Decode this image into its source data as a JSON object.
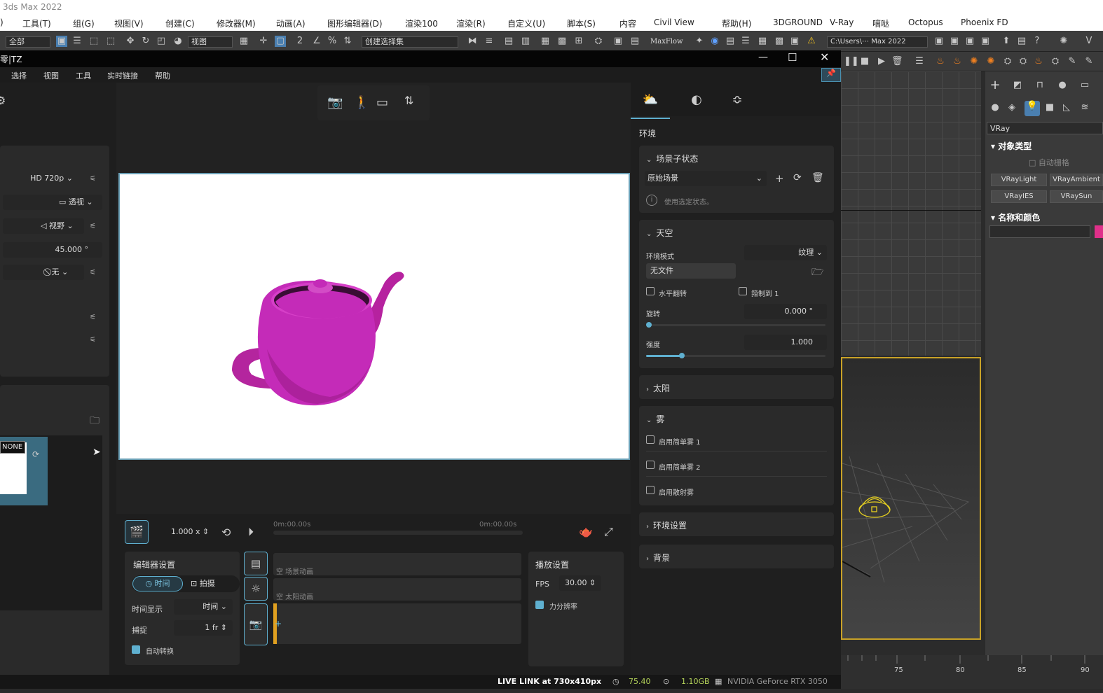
{
  "max": {
    "title": "3ds Max 2022",
    "menus": [
      "工具(T)",
      "组(G)",
      "视图(V)",
      "创建(C)",
      "修改器(M)",
      "动画(A)",
      "图形编辑器(D)",
      "渲染100",
      "渲染(R)",
      "自定义(U)",
      "脚本(S)",
      "内容",
      "Civil View",
      "帮助(H)",
      "3DGROUND",
      "V-Ray",
      "嘀哒",
      "Octopus",
      "Phoenix FD"
    ],
    "selection_filter": "全部",
    "ref_coord": "视图",
    "named_sel": "创建选择集",
    "maxflow": "MaxFlow",
    "path": "C:\\Users\\⋯ Max 2022",
    "cmd": {
      "category": "VRay",
      "section_object_type": "对象类型",
      "autogrid": "自动栅格",
      "buttons": [
        "VRayLight",
        "VRayAmbient",
        "VRayIES",
        "VRaySun"
      ],
      "section_name_color": "名称和颜色"
    },
    "ruler": [
      "75",
      "80",
      "85",
      "90"
    ]
  },
  "vantage": {
    "title": "零|TZ",
    "menus": [
      "选择",
      "视图",
      "工具",
      "实时链接",
      "帮助"
    ],
    "camera": {
      "resolution": "HD 720p",
      "projection": "透视",
      "fov_mode": "视野",
      "fov": "45.000 °",
      "dof": "无"
    },
    "thumb": {
      "label": "NONE"
    },
    "timeline": {
      "speed": "1.000 x",
      "time_start": "0m:00.00s",
      "time_end": "0m:00.00s",
      "editor_title": "编辑器设置",
      "mode_time": "时间",
      "mode_shot": "拍摄",
      "time_display_label": "时间显示",
      "time_display": "时间",
      "snap_label": "捕捉",
      "snap": "1 fr",
      "auto_convert": "自动转换",
      "track_scene": "空 场景动画",
      "track_sun": "空 太阳动画",
      "playback_title": "播放设置",
      "fps_label": "FPS",
      "fps": "30.00",
      "force_res": "力分辨率"
    },
    "env": {
      "title": "环境",
      "scene_state": {
        "title": "场景子状态",
        "value": "原始场景",
        "hint": "使用选定状态。"
      },
      "sky": {
        "title": "天空",
        "mode_label": "环境模式",
        "mode": "纹理",
        "file": "无文件",
        "flip": "水平翻转",
        "clamp": "箝制到 1",
        "rotation_label": "旋转",
        "rotation": "0.000 °",
        "intensity_label": "强度",
        "intensity": "1.000",
        "rotation_fraction": 0.0,
        "intensity_fraction": 0.2
      },
      "sun": {
        "title": "太阳"
      },
      "fog": {
        "title": "雾",
        "items": [
          "启用简单雾 1",
          "启用简单雾 2",
          "启用散射雾"
        ]
      },
      "env_settings": {
        "title": "环境设置"
      },
      "background": {
        "title": "背景"
      }
    },
    "status": {
      "link": "LIVE LINK at 730x410px",
      "fps": "75.40",
      "mem": "1.10GB",
      "gpu": "NVIDIA GeForce RTX 3050"
    }
  },
  "colors": {
    "teapot": "#c42bb8",
    "accent": "#5fb0d0",
    "frame": "#c9a227"
  }
}
